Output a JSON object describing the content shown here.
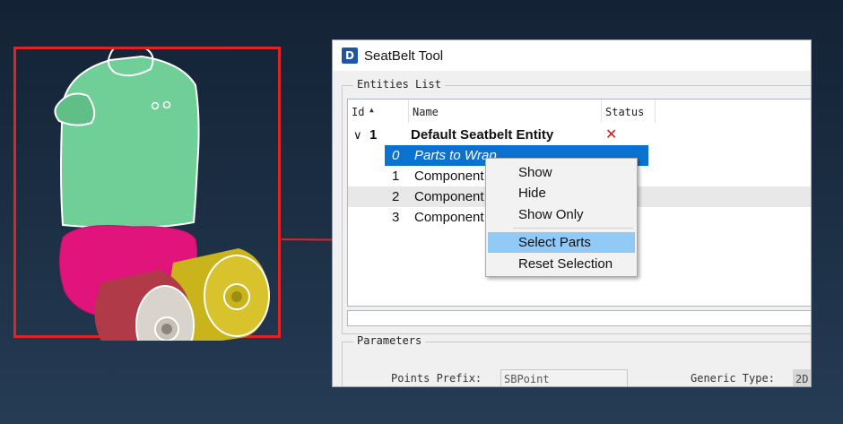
{
  "colors": {
    "highlight_frame": "#e02424",
    "arrow": "#e02424",
    "selection": "#0a73d1",
    "menu_highlight": "#91c9f7",
    "status_x": "#d01818",
    "torso": "#6fcf97",
    "pelvis": "#e0147a",
    "left_thigh": "#b03a48",
    "right_thigh": "#c9b41c"
  },
  "icons": {
    "app": "app-logo-icon",
    "expand": "chevron-down-icon",
    "status": "x-mark-icon",
    "sort": "sort-ascending-icon"
  },
  "dialog": {
    "title": "SeatBelt Tool",
    "app_icon_glyph": "D"
  },
  "entities": {
    "group_title": "Entities List",
    "columns": {
      "id": "Id",
      "name": "Name",
      "status": "Status"
    },
    "parent": {
      "expand_glyph": "∨",
      "id": "1",
      "name": "Default Seatbelt Entity",
      "status": "✕"
    },
    "children": [
      {
        "id": "0",
        "name": "Parts to Wrap"
      },
      {
        "id": "1",
        "name": "Component"
      },
      {
        "id": "2",
        "name": "Component"
      },
      {
        "id": "3",
        "name": "Component"
      }
    ]
  },
  "context_menu": {
    "items": [
      "Show",
      "Hide",
      "Show Only",
      "Select Parts",
      "Reset Selection"
    ],
    "highlighted": "Select Parts"
  },
  "parameters": {
    "group_title": "Parameters",
    "points_prefix_label": "Points Prefix:",
    "points_prefix_value": "SBPoint",
    "generic_type_label": "Generic Type:",
    "generic_type_value": "2D"
  }
}
